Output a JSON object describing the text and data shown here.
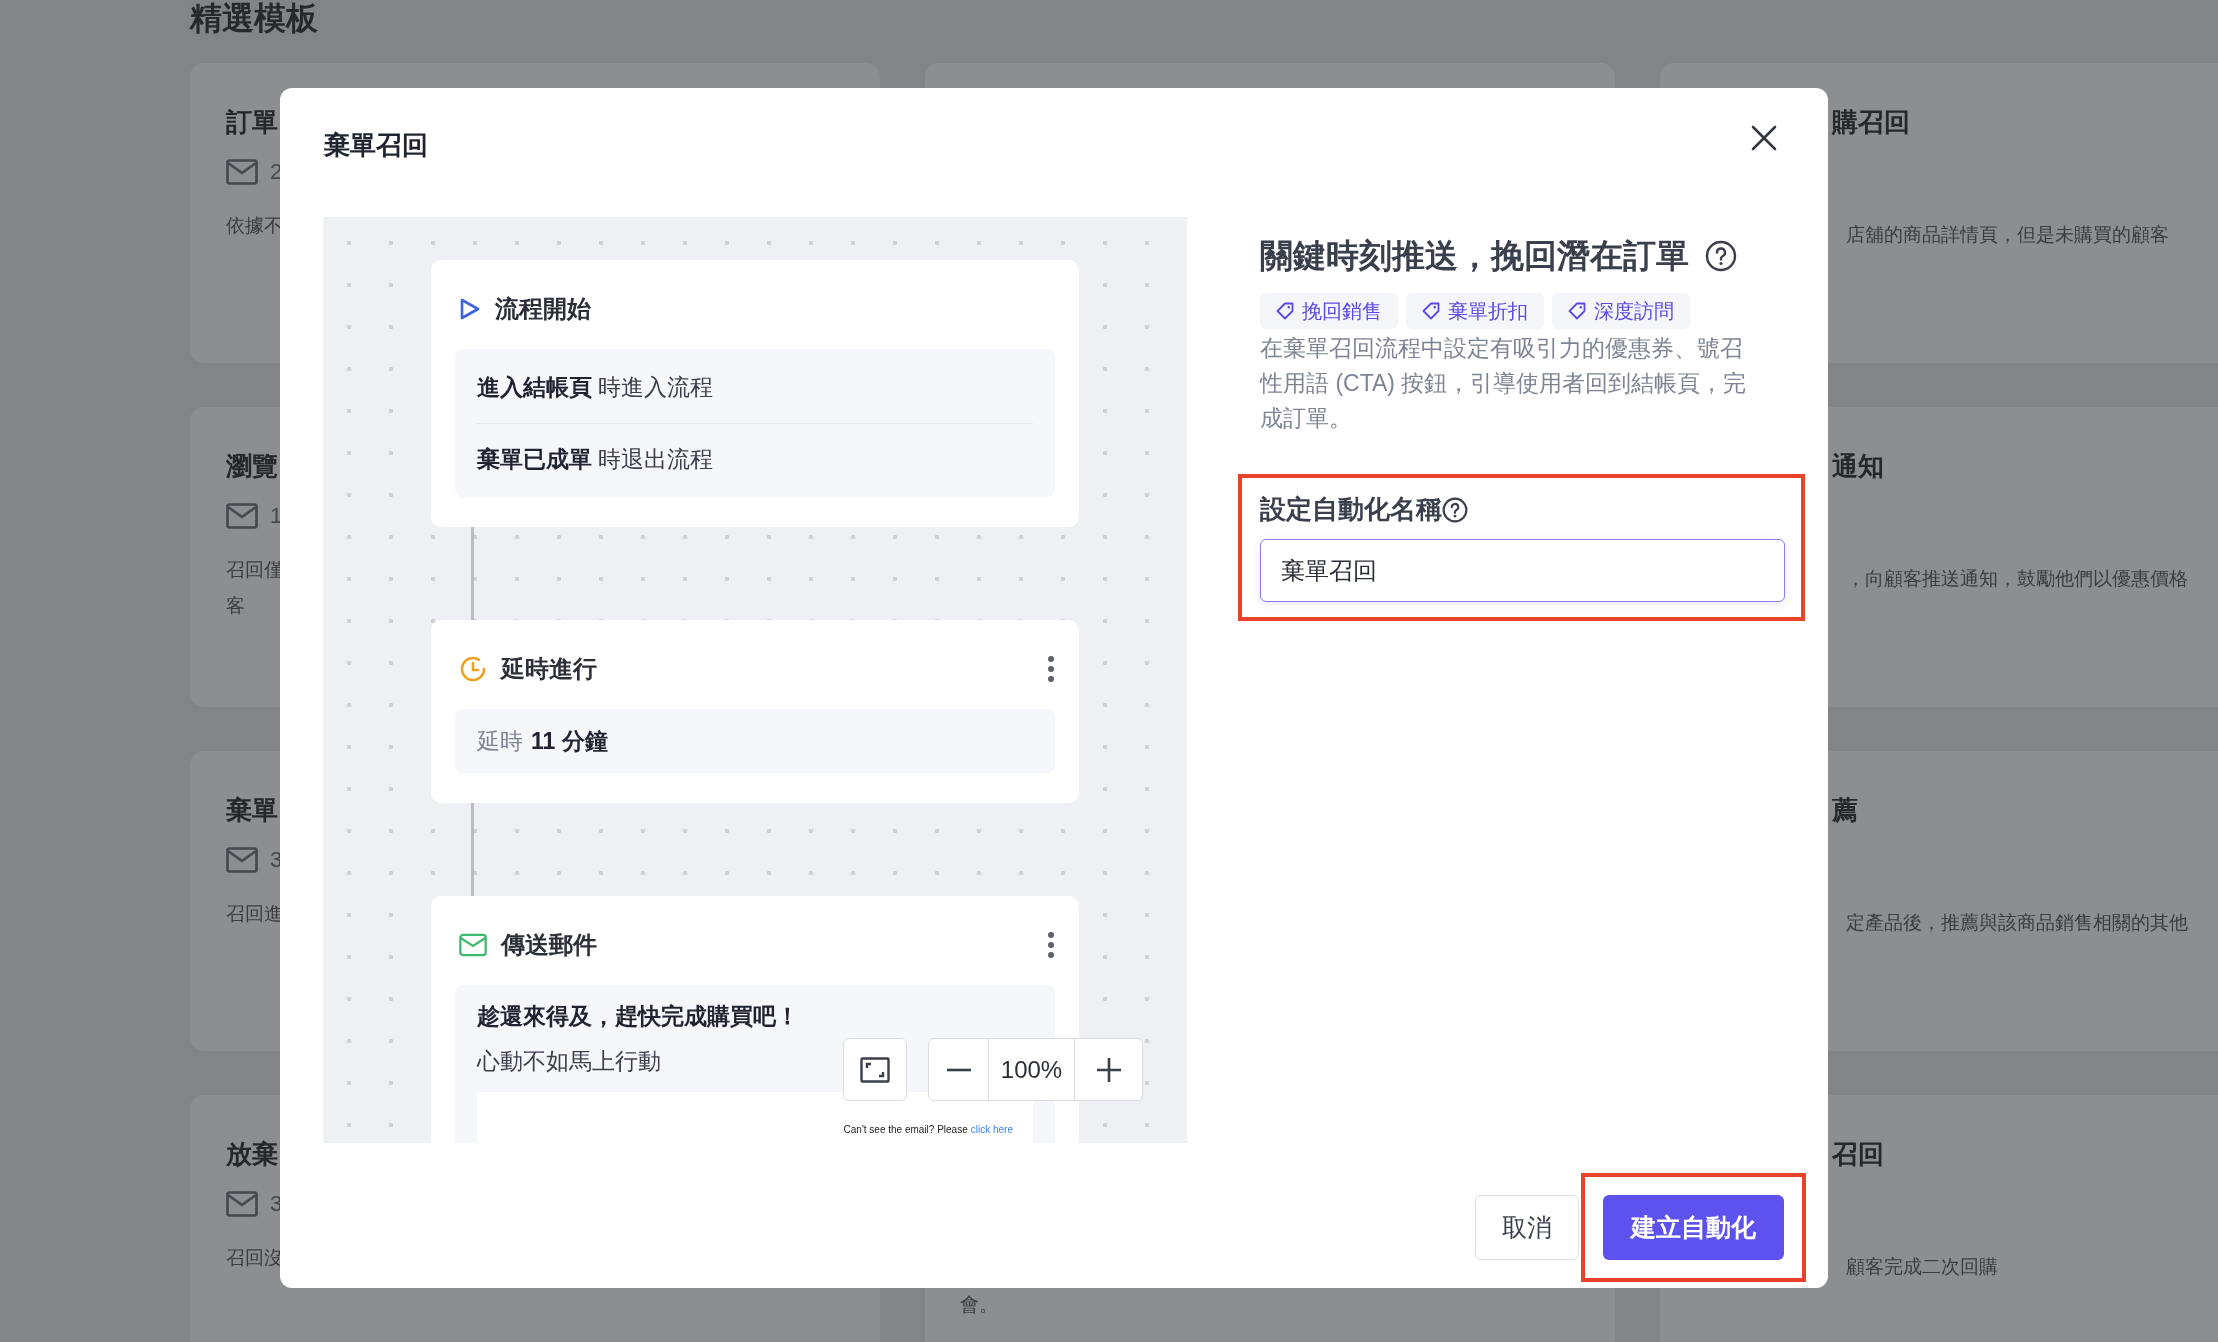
{
  "background": {
    "heading": "精選模板",
    "column_1": [
      {
        "title": "訂單",
        "count": "2",
        "description": "依據不"
      },
      {
        "title": "瀏覽",
        "count": "1",
        "description": "召回僅客"
      },
      {
        "title": "棄單",
        "count": "3",
        "description": "召回進"
      },
      {
        "title": "放棄",
        "count": "3",
        "description": "召回沒"
      }
    ],
    "column_2": [
      {
        "text": "會。"
      }
    ],
    "column_3": [
      {
        "title": "購召回",
        "description": "店舖的商品詳情頁，但是未購買的顧客"
      },
      {
        "title": "通知",
        "description": "，向顧客推送通知，鼓勵他們以優惠價格"
      },
      {
        "title": "薦",
        "description": "定產品後，推薦與該商品銷售相關的其他"
      },
      {
        "title": "召回",
        "description": "顧客完成二次回購"
      }
    ]
  },
  "modal": {
    "title": "棄單召回",
    "flow": [
      {
        "kind": "start",
        "title": "流程開始",
        "has_menu": false,
        "rows": [
          "**進入結帳頁** 時進入流程",
          "**棄單已成單** 時退出流程"
        ]
      },
      {
        "kind": "delay",
        "title": "延時進行",
        "has_menu": true,
        "rows": [
          "延時**11 分鐘**"
        ]
      },
      {
        "kind": "email",
        "title": "傳送郵件",
        "has_menu": true,
        "rows": [
          "趁還來得及，趕快完成購買吧！",
          "心動不如馬上行動"
        ],
        "preview_text": "Can't see the email? Please",
        "preview_link": "click here"
      }
    ],
    "zoom_level": "100%",
    "heading": "關鍵時刻推送，挽回潛在訂單",
    "tags": [
      "挽回銷售",
      "棄單折扣",
      "深度訪問"
    ],
    "description": "在棄單召回流程中設定有吸引力的優惠券、號召性用語 (CTA) 按鈕，引導使用者回到結帳頁，完成訂單。",
    "name_field": {
      "label": "設定自動化名稱",
      "value": "棄單召回",
      "highlighted": true
    },
    "buttons": [
      {
        "kind": "secondary",
        "label": "取消",
        "highlighted": false
      },
      {
        "kind": "primary",
        "label": "建立自動化",
        "highlighted": true
      }
    ]
  }
}
